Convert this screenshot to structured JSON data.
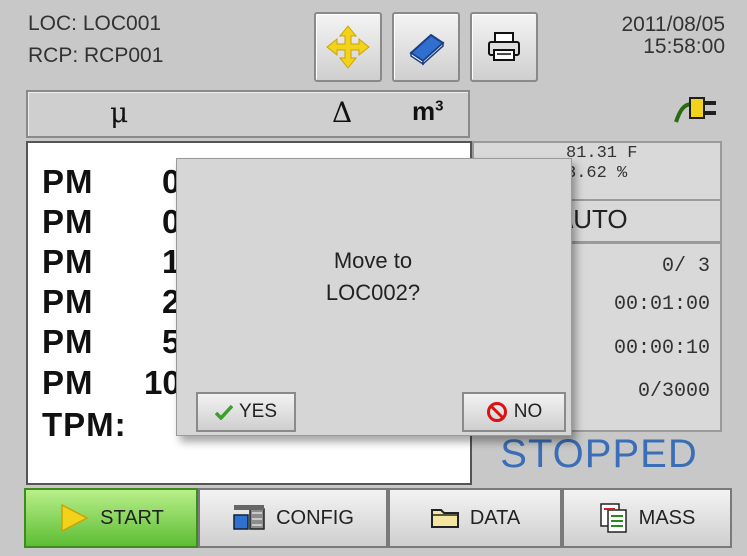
{
  "header": {
    "loc": "LOC:  LOC001",
    "rcp": "RCP:  RCP001",
    "date": "2011/08/05",
    "time": "15:58:00"
  },
  "toolbar": [
    {
      "icon": "move-arrows-icon"
    },
    {
      "icon": "book-icon"
    },
    {
      "icon": "printer-icon"
    }
  ],
  "units": {
    "mu": "μ",
    "delta": "Δ",
    "m3_base": "m",
    "m3_exp": "3"
  },
  "data_rows": [
    {
      "label": "PM",
      "value": "0"
    },
    {
      "label": "PM",
      "value": "0"
    },
    {
      "label": "PM",
      "value": "1"
    },
    {
      "label": "PM",
      "value": "2"
    },
    {
      "label": "PM",
      "value": "5"
    },
    {
      "label": "PM",
      "value": "10"
    }
  ],
  "tpm_label": "TPM:",
  "right_panel": {
    "temp": "81.31  F",
    "humidity": "3.62  %",
    "mode": "\\UTO",
    "count": "0/   3",
    "interval": "00:01:00",
    "hold": "00:00:10",
    "volume": "0/3000",
    "status": "STOPPED"
  },
  "dialog": {
    "line1": "Move to",
    "line2": "LOC002?",
    "yes_label": "YES",
    "no_label": "NO"
  },
  "nav": {
    "start": "START",
    "config": "CONFIG",
    "data": "DATA",
    "mass": "MASS"
  },
  "colors": {
    "status_blue": "#3a6fb8",
    "start_green": "#5dbd34",
    "accent_yellow": "#f2d21b"
  }
}
